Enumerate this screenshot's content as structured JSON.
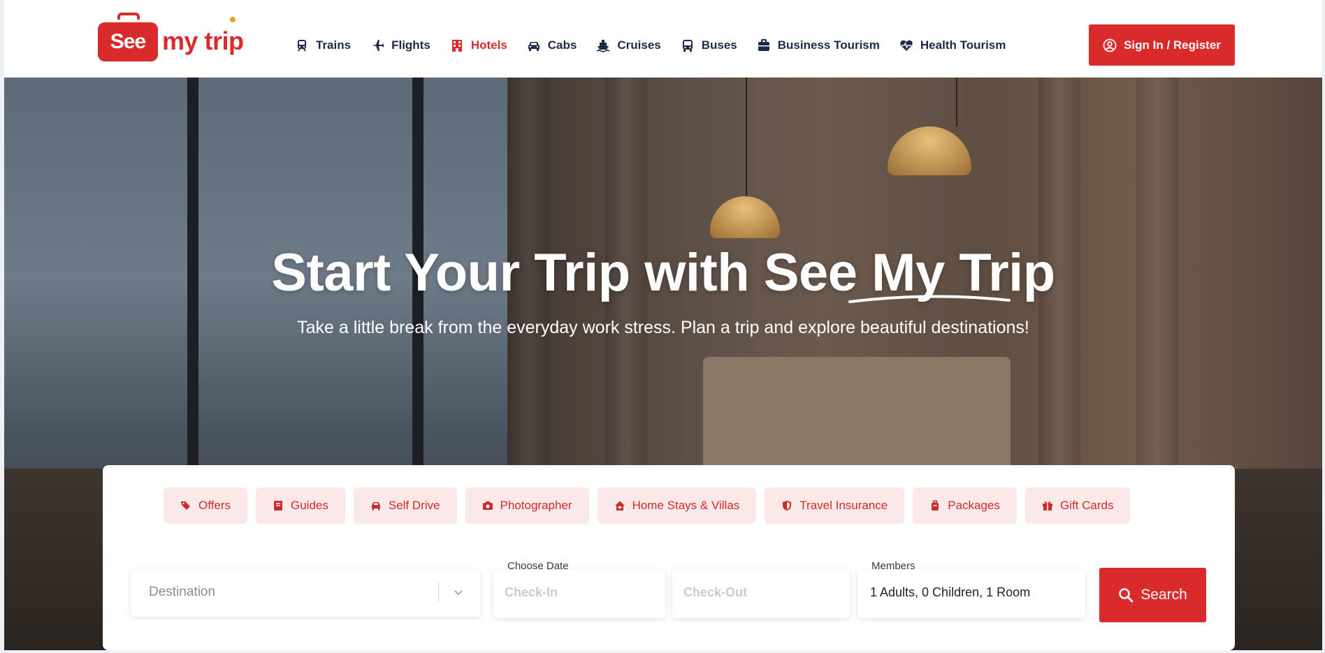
{
  "brand": {
    "badge_text": "See",
    "name_text": "my trip"
  },
  "nav": {
    "items": [
      {
        "label": "Trains",
        "icon": "train-icon",
        "active": false
      },
      {
        "label": "Flights",
        "icon": "plane-icon",
        "active": false
      },
      {
        "label": "Hotels",
        "icon": "hotel-icon",
        "active": true
      },
      {
        "label": "Cabs",
        "icon": "car-icon",
        "active": false
      },
      {
        "label": "Cruises",
        "icon": "ship-icon",
        "active": false
      },
      {
        "label": "Buses",
        "icon": "bus-icon",
        "active": false
      },
      {
        "label": "Business Tourism",
        "icon": "briefcase-icon",
        "active": false
      },
      {
        "label": "Health Tourism",
        "icon": "heart-pulse-icon",
        "active": false
      }
    ]
  },
  "auth": {
    "signin_label": "Sign In / Register",
    "icon": "user-circle-icon"
  },
  "hero": {
    "title": "Start Your Trip with See My Trip",
    "subtitle": "Take a little break from the everyday work stress. Plan a trip and explore beautiful destinations!"
  },
  "services": [
    {
      "label": "Offers",
      "icon": "tags-icon"
    },
    {
      "label": "Guides",
      "icon": "book-icon"
    },
    {
      "label": "Self Drive",
      "icon": "car-icon"
    },
    {
      "label": "Photographer",
      "icon": "camera-icon"
    },
    {
      "label": "Home Stays & Villas",
      "icon": "house-icon"
    },
    {
      "label": "Travel Insurance",
      "icon": "shield-icon"
    },
    {
      "label": "Packages",
      "icon": "luggage-icon"
    },
    {
      "label": "Gift Cards",
      "icon": "gift-icon"
    }
  ],
  "search": {
    "destination_placeholder": "Destination",
    "date_label": "Choose Date",
    "checkin_placeholder": "Check-In",
    "checkout_placeholder": "Check-Out",
    "members_label": "Members",
    "members_value": "1 Adults, 0 Children, 1 Room",
    "button_label": "Search"
  },
  "colors": {
    "accent": "#d92b2b",
    "nav_text": "#1c2a4a",
    "chip_bg": "#fbe9e9"
  }
}
